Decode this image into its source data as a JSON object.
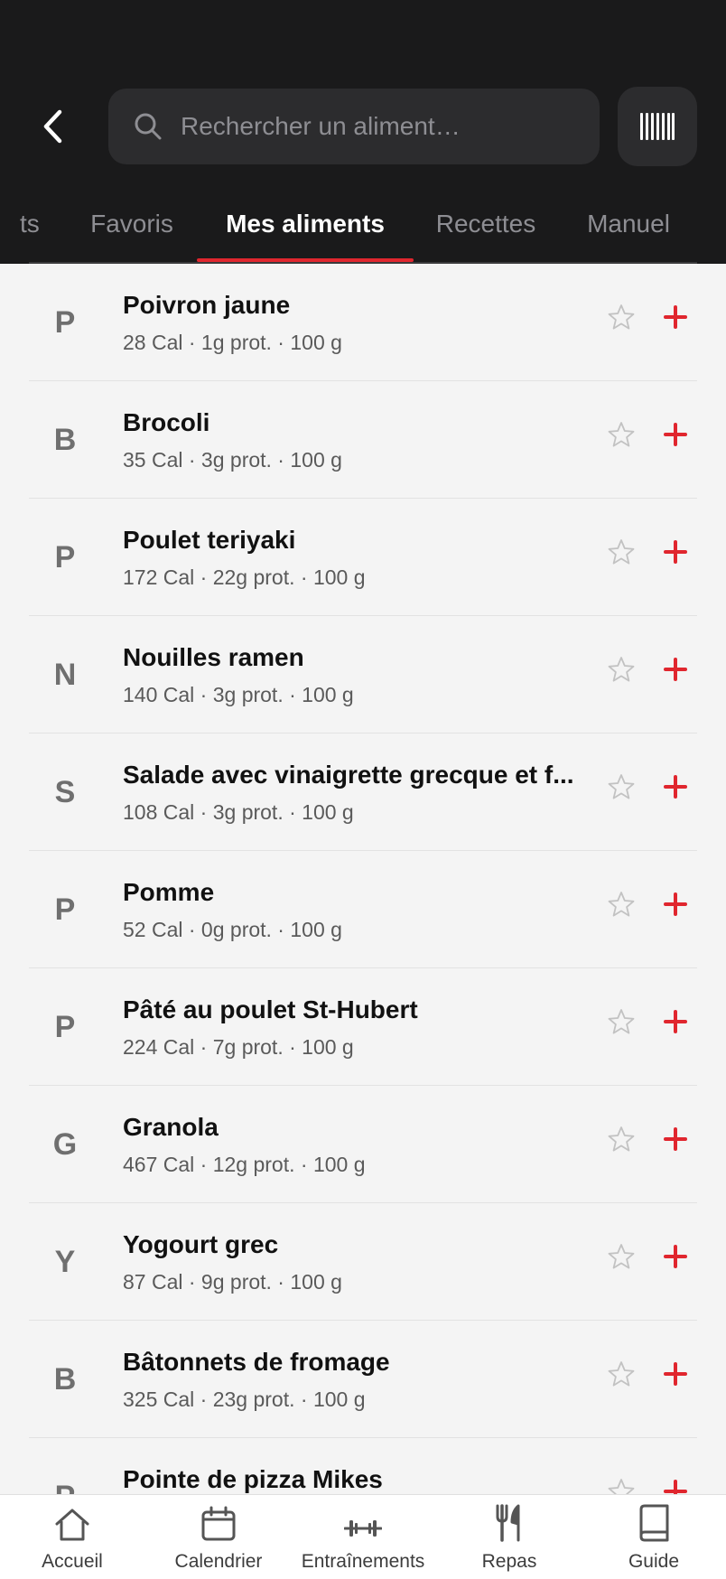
{
  "search": {
    "placeholder": "Rechercher un aliment…"
  },
  "tabs": [
    {
      "label": "ts",
      "active": false
    },
    {
      "label": "Favoris",
      "active": false
    },
    {
      "label": "Mes aliments",
      "active": true
    },
    {
      "label": "Recettes",
      "active": false
    },
    {
      "label": "Manuel",
      "active": false
    }
  ],
  "foods": [
    {
      "letter": "P",
      "name": "Poivron jaune",
      "meta": "28 Cal · 1g prot. · 100 g"
    },
    {
      "letter": "B",
      "name": "Brocoli",
      "meta": "35 Cal · 3g prot. · 100 g"
    },
    {
      "letter": "P",
      "name": "Poulet teriyaki",
      "meta": "172 Cal · 22g prot. · 100 g"
    },
    {
      "letter": "N",
      "name": "Nouilles ramen",
      "meta": "140 Cal · 3g prot. · 100 g"
    },
    {
      "letter": "S",
      "name": "Salade avec vinaigrette grecque et f...",
      "meta": "108 Cal · 3g prot. · 100 g"
    },
    {
      "letter": "P",
      "name": "Pomme",
      "meta": "52 Cal · 0g prot. · 100 g"
    },
    {
      "letter": "P",
      "name": "Pâté au poulet St-Hubert",
      "meta": "224 Cal · 7g prot. · 100 g"
    },
    {
      "letter": "G",
      "name": "Granola",
      "meta": "467 Cal · 12g prot. · 100 g"
    },
    {
      "letter": "Y",
      "name": "Yogourt grec",
      "meta": "87 Cal · 9g prot. · 100 g"
    },
    {
      "letter": "B",
      "name": "Bâtonnets de fromage",
      "meta": "325 Cal · 23g prot. · 100 g"
    },
    {
      "letter": "P",
      "name": "Pointe de pizza Mikes",
      "meta": ""
    }
  ],
  "nav": [
    {
      "label": "Accueil",
      "icon": "home-icon"
    },
    {
      "label": "Calendrier",
      "icon": "calendar-icon"
    },
    {
      "label": "Entraînements",
      "icon": "dumbbell-icon"
    },
    {
      "label": "Repas",
      "icon": "fork-knife-icon"
    },
    {
      "label": "Guide",
      "icon": "book-icon"
    }
  ],
  "colors": {
    "accent": "#e0262e",
    "header_bg": "#1a1a1b",
    "list_bg": "#f4f4f4"
  }
}
